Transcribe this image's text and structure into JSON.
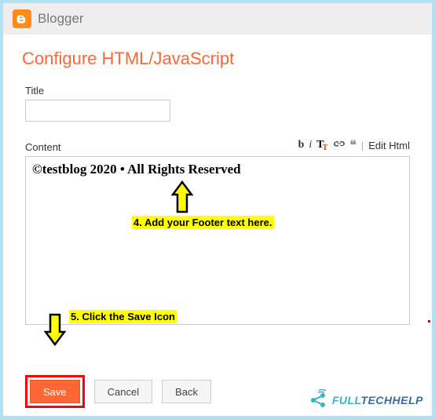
{
  "header": {
    "app_name": "Blogger"
  },
  "page": {
    "title": "Configure HTML/JavaScript"
  },
  "form": {
    "title_label": "Title",
    "title_value": "",
    "content_label": "Content",
    "content_value": "©testblog 2020 • All Rights Reserved"
  },
  "toolbar": {
    "bold": "b",
    "italic": "i",
    "sep": "|",
    "edit_html": "Edit Html"
  },
  "buttons": {
    "save": "Save",
    "cancel": "Cancel",
    "back": "Back"
  },
  "annotations": {
    "step4": "4. Add your Footer text here.",
    "step5": "5. Click the Save Icon"
  },
  "watermark": {
    "full": "FULL",
    "tech": "TECHHELP"
  }
}
